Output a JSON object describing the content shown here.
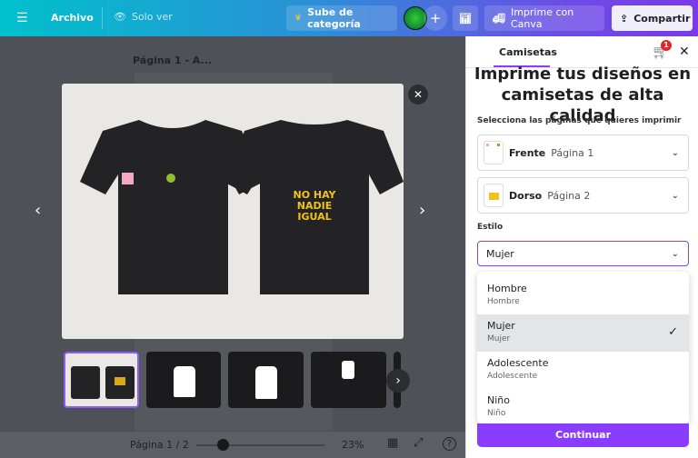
{
  "topbar": {
    "menu_icon": "hamburger-icon",
    "file": "Archivo",
    "view_mode": "Solo ver",
    "upgrade": "Sube de categoría",
    "add": "+",
    "print": "Imprime con Canva",
    "share": "Compartir"
  },
  "editor": {
    "page_label": "Página 1 - A...",
    "pager": "Página 1 / 2",
    "zoom": "23%",
    "zoom_value": 23
  },
  "preview": {
    "back_text": "NO HAY\nNADIE\nIGUAL",
    "thumbnails": [
      "front-back",
      "white-front",
      "white-back",
      "white-small"
    ]
  },
  "panel": {
    "tab": "Camisetas",
    "cart_count": "1",
    "title_line1": "Imprime tus diseños en",
    "title_line2": "camisetas de alta calidad",
    "select_label": "Selecciona las páginas que quieres imprimir",
    "pages": [
      {
        "side": "Frente",
        "page": "Página 1"
      },
      {
        "side": "Dorso",
        "page": "Página 2"
      }
    ],
    "style_label": "Estilo",
    "style_value": "Mujer",
    "options": [
      {
        "label": "Hombre",
        "sub": "Hombre"
      },
      {
        "label": "Mujer",
        "sub": "Mujer",
        "selected": true
      },
      {
        "label": "Adolescente",
        "sub": "Adolescente"
      },
      {
        "label": "Niño",
        "sub": "Niño"
      }
    ],
    "continue": "Continuar"
  },
  "colors": {
    "accent": "#8b3dff",
    "selected_bg": "#e4e5e9"
  }
}
